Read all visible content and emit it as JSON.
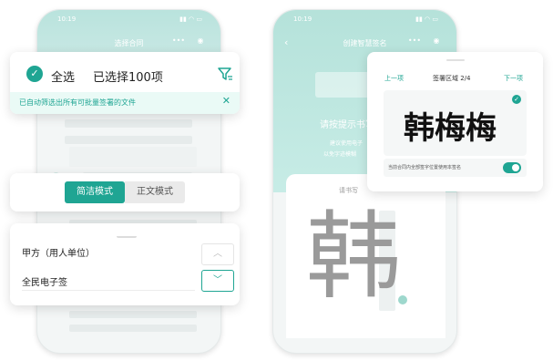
{
  "left_phone": {
    "time": "10:19",
    "title": "选择合同"
  },
  "select_bar": {
    "select_all": "全选",
    "selected_count": "已选择100项",
    "notice": "已自动筛选出所有可批量签署的文件",
    "colors": {
      "accent": "#1fa593",
      "notice_bg": "#eafaf6"
    }
  },
  "mode_tabs": {
    "simple": "简洁模式",
    "full": "正文模式",
    "active": "simple"
  },
  "party_card": {
    "label": "甲方（用人单位）",
    "value": "全民电子签"
  },
  "right_phone": {
    "time": "10:19",
    "title": "创建智慧签名",
    "prompt": "请按提示书写",
    "hint_line1": "建议使用电子",
    "hint_line2": "以免字迹模糊",
    "pad_label": "请书写",
    "big_char": "韩"
  },
  "sig_card": {
    "prev": "上一项",
    "region": "签署区域 2/4",
    "next": "下一项",
    "signature": "韩梅梅",
    "apply_all": "当前合同内全部签字位置使用本签名",
    "toggle_on": true
  }
}
